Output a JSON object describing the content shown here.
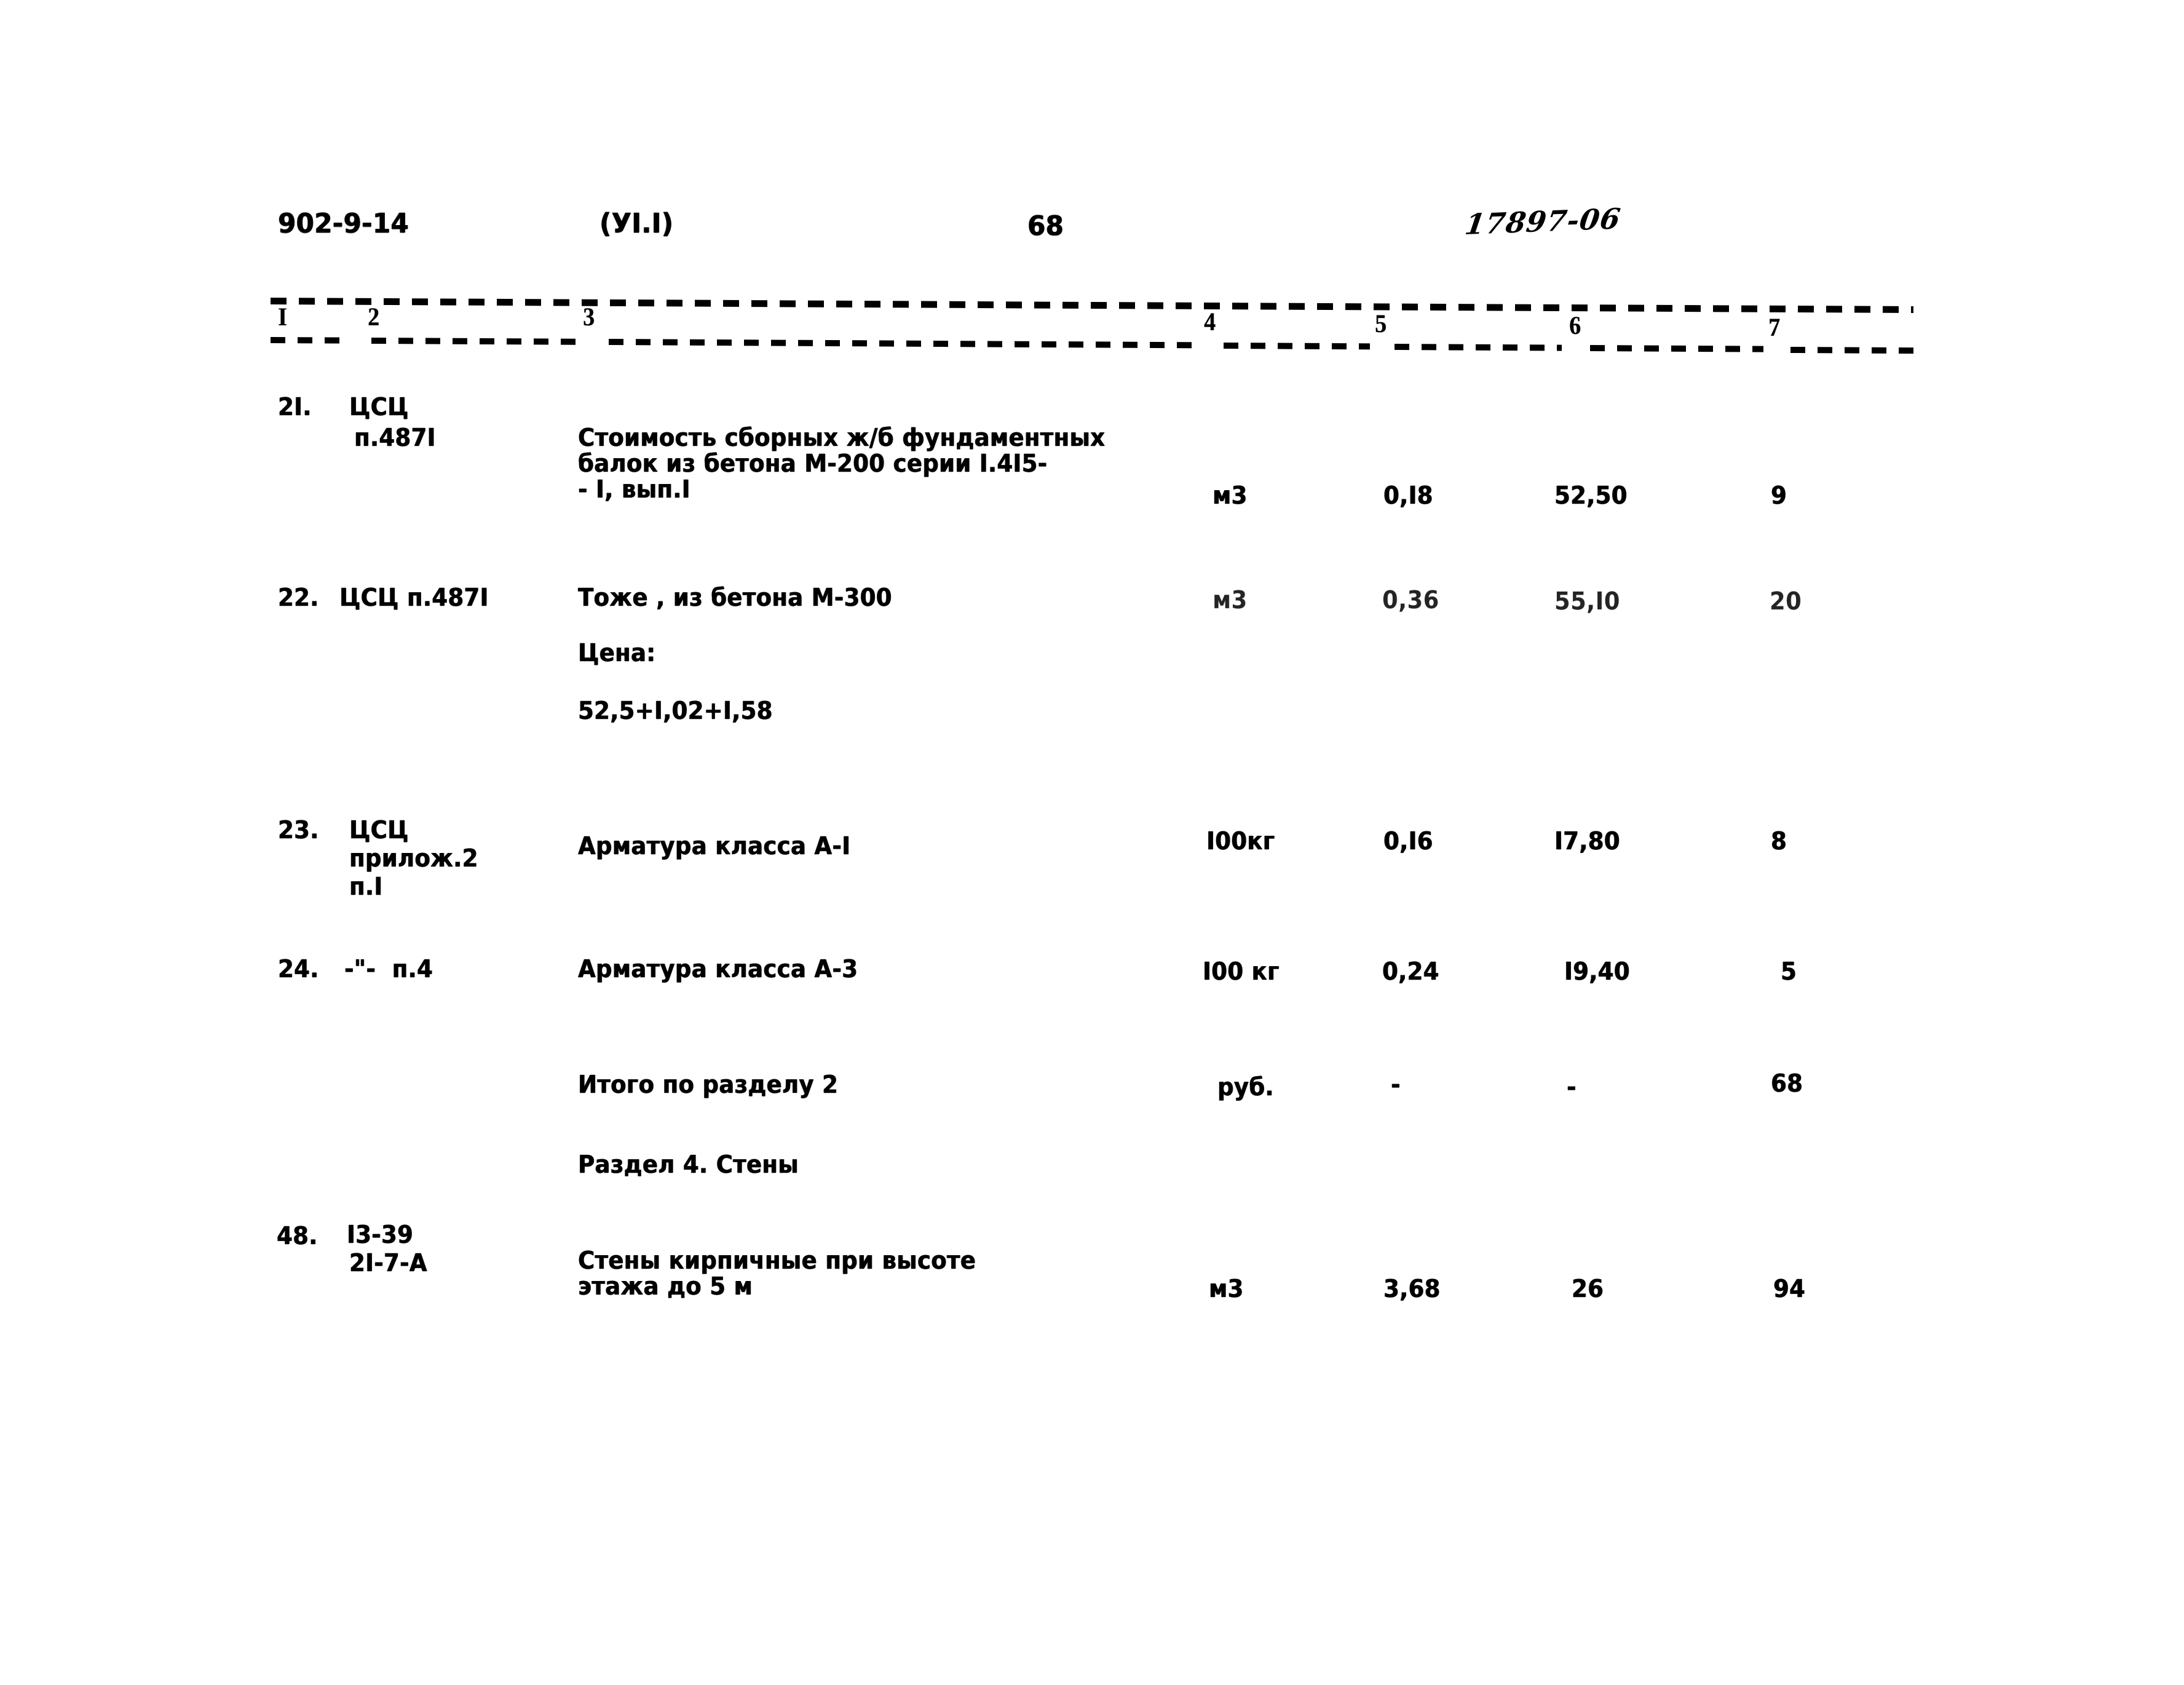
{
  "document": {
    "series_code": "902-9-14",
    "volume_ref": "(УI.I)",
    "page_number": "68",
    "archive_number": "17897-06"
  },
  "table": {
    "column_headers": [
      "I",
      "2",
      "3",
      "4",
      "5",
      "6",
      "7"
    ],
    "rows": [
      {
        "num": "2I.",
        "justification_lines": [
          "ЦСЦ",
          "п.487I"
        ],
        "description_lines": [
          "Стоимость сборных ж/б фундаментных",
          "балок из бетона М-200 серии I.4I5-",
          "- I, вып.I"
        ],
        "unit": "м3",
        "quantity": "0,I8",
        "unit_price": "52,50",
        "total": "9"
      },
      {
        "num": "22.",
        "justification_lines": [
          "ЦСЦ п.487I"
        ],
        "description_lines": [
          "Тоже , из бетона М-300",
          "Цена:",
          "52,5+I,02+I,58"
        ],
        "unit": "м3",
        "quantity": "0,36",
        "unit_price": "55,I0",
        "total": "20",
        "faded_numbers": true
      },
      {
        "num": "23.",
        "justification_lines": [
          "ЦСЦ",
          "прилож.2",
          "п.I"
        ],
        "description_lines": [
          "Арматура класса А-I"
        ],
        "unit": "I00кг",
        "quantity": "0,I6",
        "unit_price": "I7,80",
        "total": "8"
      },
      {
        "num": "24.",
        "justification_lines": [
          "-\"-  п.4"
        ],
        "description_lines": [
          "Арматура класса А-3"
        ],
        "unit": "I00 кг",
        "quantity": "0,24",
        "unit_price": "I9,40",
        "total": "5"
      },
      {
        "num": "",
        "justification_lines": [],
        "description_lines": [
          "Итого по разделу 2"
        ],
        "unit": "руб.",
        "quantity": "-",
        "unit_price": "-",
        "total": "68"
      },
      {
        "num": "",
        "justification_lines": [],
        "description_lines": [
          "Раздел 4. Стены"
        ],
        "unit": "",
        "quantity": "",
        "unit_price": "",
        "total": ""
      },
      {
        "num": "48.",
        "justification_lines": [
          "I3-39",
          "2I-7-А"
        ],
        "description_lines": [
          "Стены кирпичные при высоте",
          "этажа до 5 м"
        ],
        "unit": "м3",
        "quantity": "3,68",
        "unit_price": "26",
        "total": "94"
      }
    ]
  }
}
